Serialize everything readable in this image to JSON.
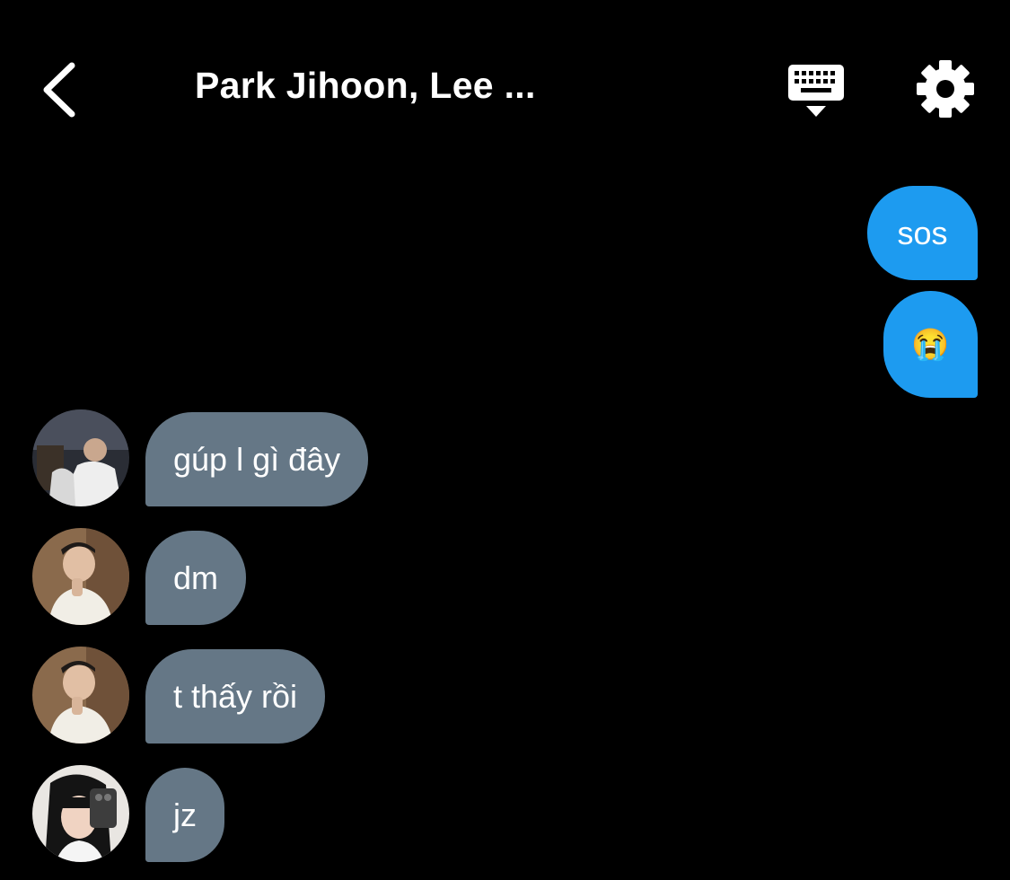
{
  "header": {
    "title": "Park Jihoon, Lee ...",
    "back_icon": "chevron-left-icon",
    "keyboard_icon": "keyboard-hide-icon",
    "settings_icon": "gear-icon"
  },
  "colors": {
    "background": "#000000",
    "outgoing_bubble": "#1d9bf0",
    "incoming_bubble": "#657786",
    "text": "#ffffff"
  },
  "messages": {
    "out": [
      {
        "text": "sos"
      },
      {
        "text": "😭"
      }
    ],
    "in": [
      {
        "text": "gúp l gì đây",
        "sender_avatar": "avatar-1"
      },
      {
        "text": "dm",
        "sender_avatar": "avatar-2"
      },
      {
        "text": "t thấy rồi",
        "sender_avatar": "avatar-2"
      },
      {
        "text": "jz",
        "sender_avatar": "avatar-3"
      }
    ]
  }
}
